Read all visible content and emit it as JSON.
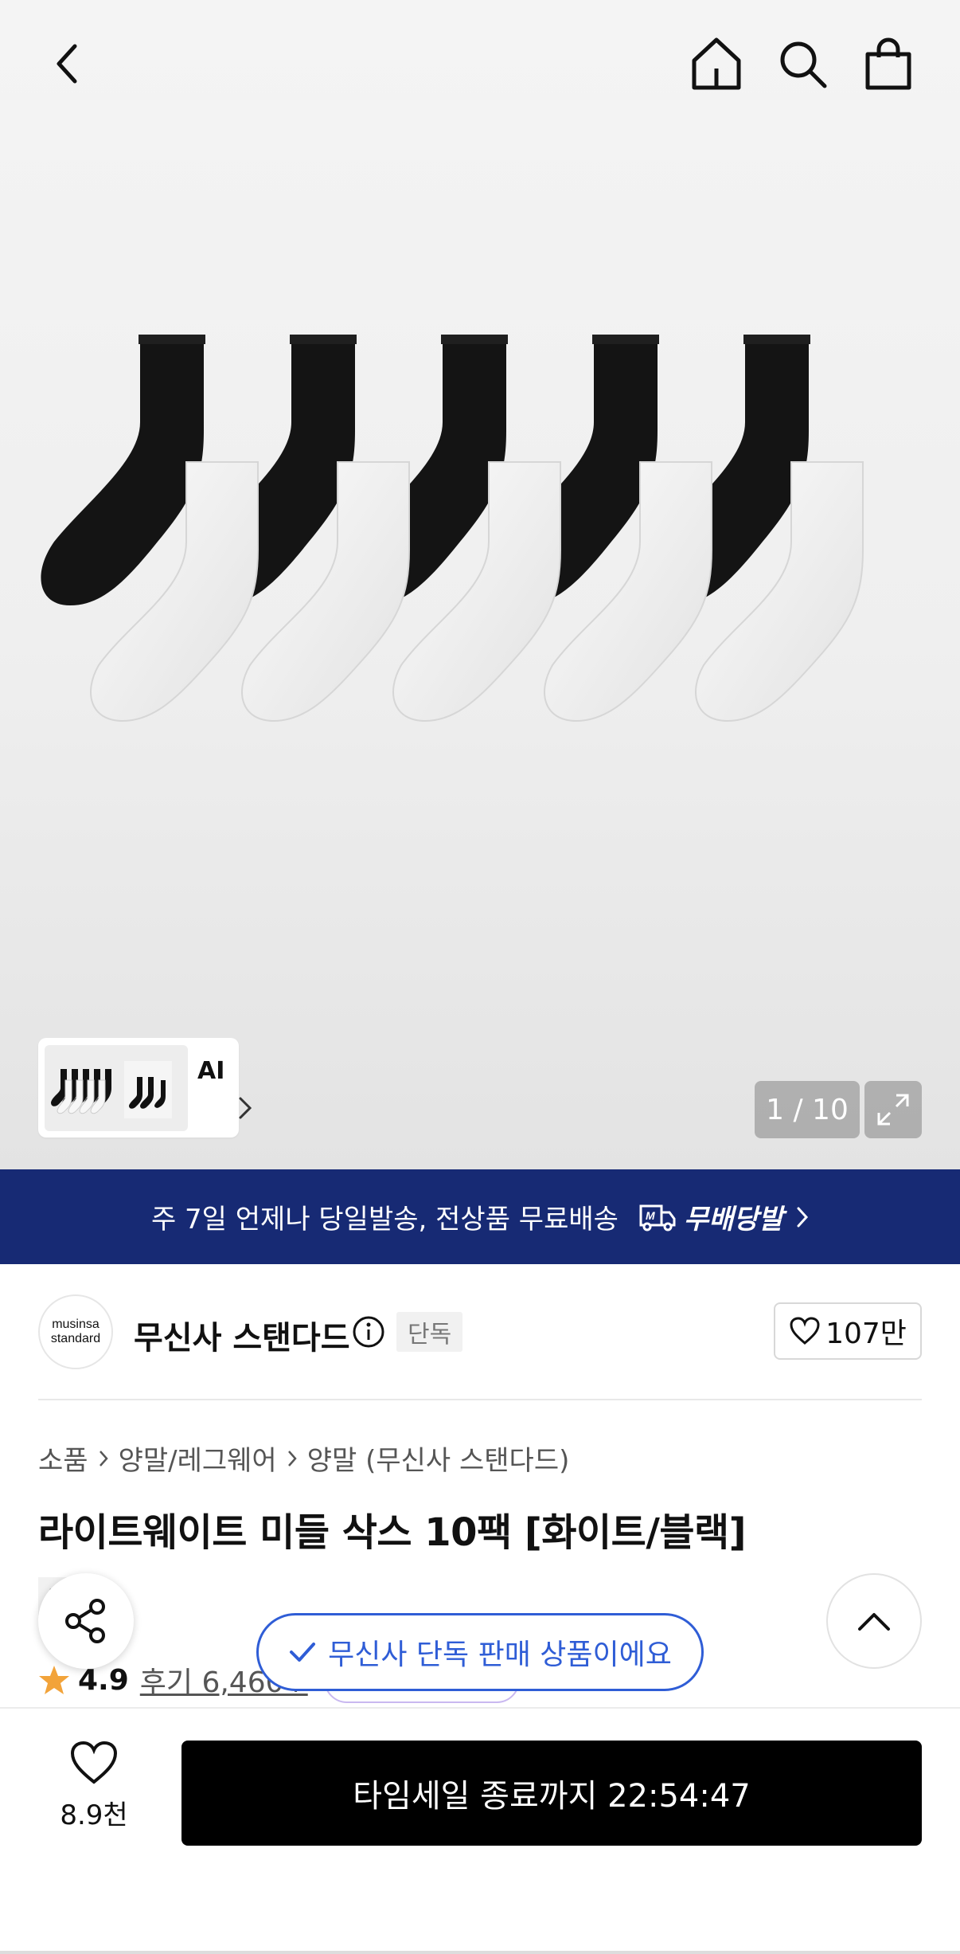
{
  "gallery": {
    "pager_current": "1",
    "pager_total": "10",
    "pager_text": "1 / 10",
    "ai_label": "AI"
  },
  "topbar": {
    "icons": [
      "back-icon",
      "home-icon",
      "search-icon",
      "shopping-bag-icon"
    ]
  },
  "banner": {
    "text": "주 7일 언제나 당일발송, 전상품 무료배송",
    "brand": "무배당발",
    "bg_color": "#172a74"
  },
  "brand": {
    "logo_line1": "musinsa",
    "logo_line2": "standard",
    "name": "무신사 스탠다드",
    "exclusive_badge": "단독",
    "likes": "107만"
  },
  "breadcrumb": {
    "items": [
      "소품",
      "양말/레그웨어",
      "양말 (무신사 스탠다드)"
    ]
  },
  "product": {
    "title": "라이트웨이트 미들 삭스 10팩 [화이트/블랙]",
    "tag": "단독",
    "rating": "4.9",
    "reviews": "후기 6,460+"
  },
  "toast": {
    "text": "무신사 단독 판매 상품이에요",
    "color": "#2f5dd6"
  },
  "bottom": {
    "wish_count": "8.9천",
    "buy_label": "타임세일 종료까지 22:54:47"
  }
}
